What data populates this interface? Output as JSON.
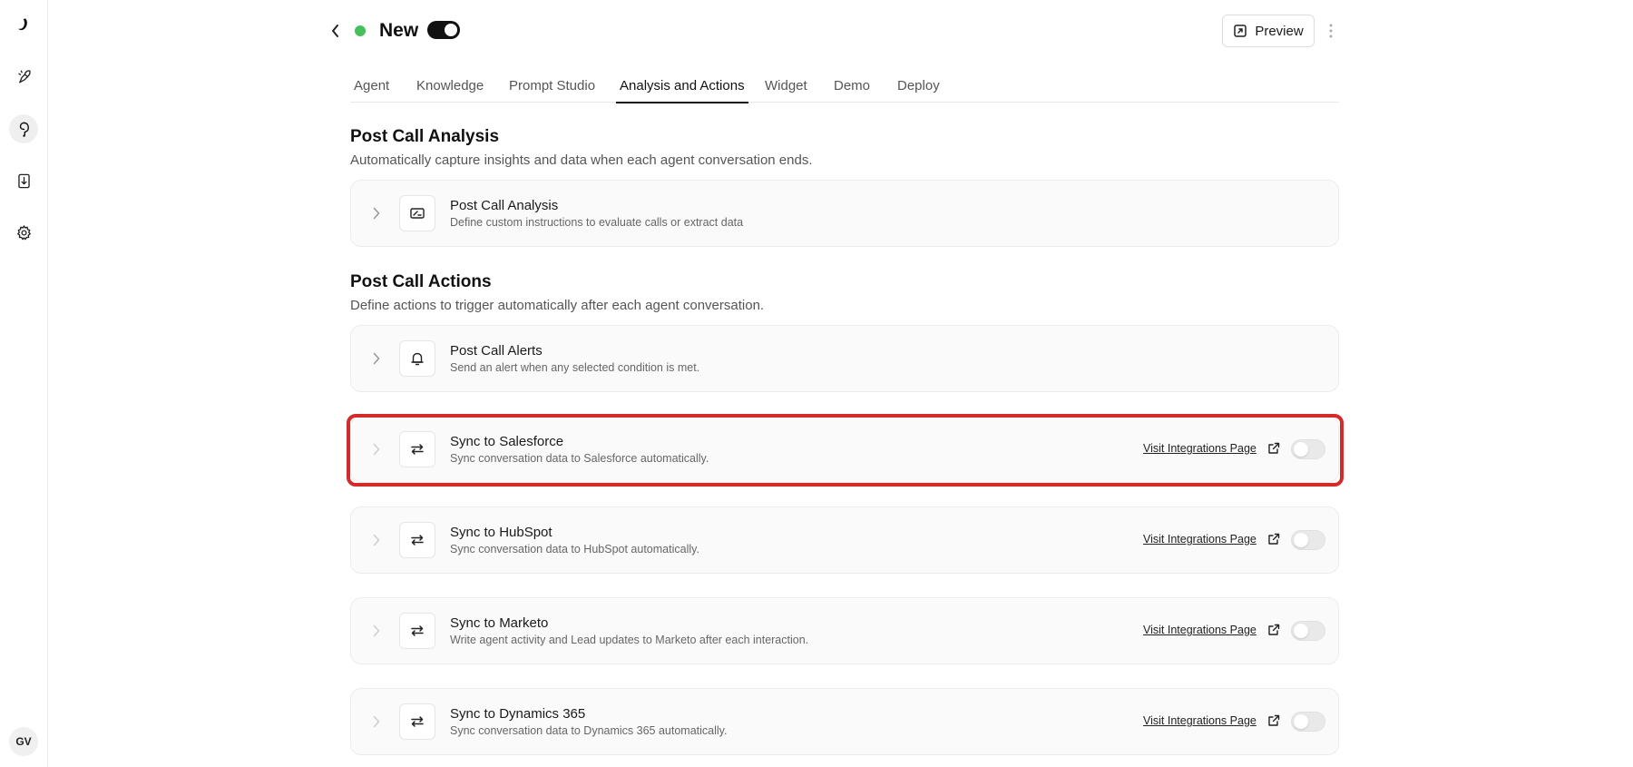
{
  "header": {
    "agent_name": "New",
    "status_color": "#45c05b",
    "preview_label": "Preview"
  },
  "tabs": [
    {
      "label": "Agent"
    },
    {
      "label": "Knowledge"
    },
    {
      "label": "Prompt Studio"
    },
    {
      "label": "Analysis and Actions"
    },
    {
      "label": "Widget"
    },
    {
      "label": "Demo"
    },
    {
      "label": "Deploy"
    }
  ],
  "analysis": {
    "title": "Post Call Analysis",
    "description": "Automatically capture insights and data when each agent conversation ends.",
    "card": {
      "title": "Post Call Analysis",
      "subtitle": "Define custom instructions to evaluate calls or extract data",
      "icon": "card-icon"
    }
  },
  "actions": {
    "title": "Post Call Actions",
    "description": "Define actions to trigger automatically after each agent conversation.",
    "alerts": {
      "title": "Post Call Alerts",
      "subtitle": "Send an alert when any selected condition is met.",
      "icon": "bell-icon"
    },
    "integrations": [
      {
        "title": "Sync to Salesforce",
        "subtitle": "Sync conversation data to Salesforce automatically.",
        "link": "Visit Integrations Page",
        "enabled": false
      },
      {
        "title": "Sync to HubSpot",
        "subtitle": "Sync conversation data to HubSpot automatically.",
        "link": "Visit Integrations Page",
        "enabled": false
      },
      {
        "title": "Sync to Marketo",
        "subtitle": "Write agent activity and Lead updates to Marketo after each interaction.",
        "link": "Visit Integrations Page",
        "enabled": false
      },
      {
        "title": "Sync to Dynamics 365",
        "subtitle": "Sync conversation data to Dynamics 365 automatically.",
        "link": "Visit Integrations Page",
        "enabled": false
      }
    ]
  },
  "user": {
    "initials": "GV"
  },
  "highlight_color": "#d42a2a"
}
